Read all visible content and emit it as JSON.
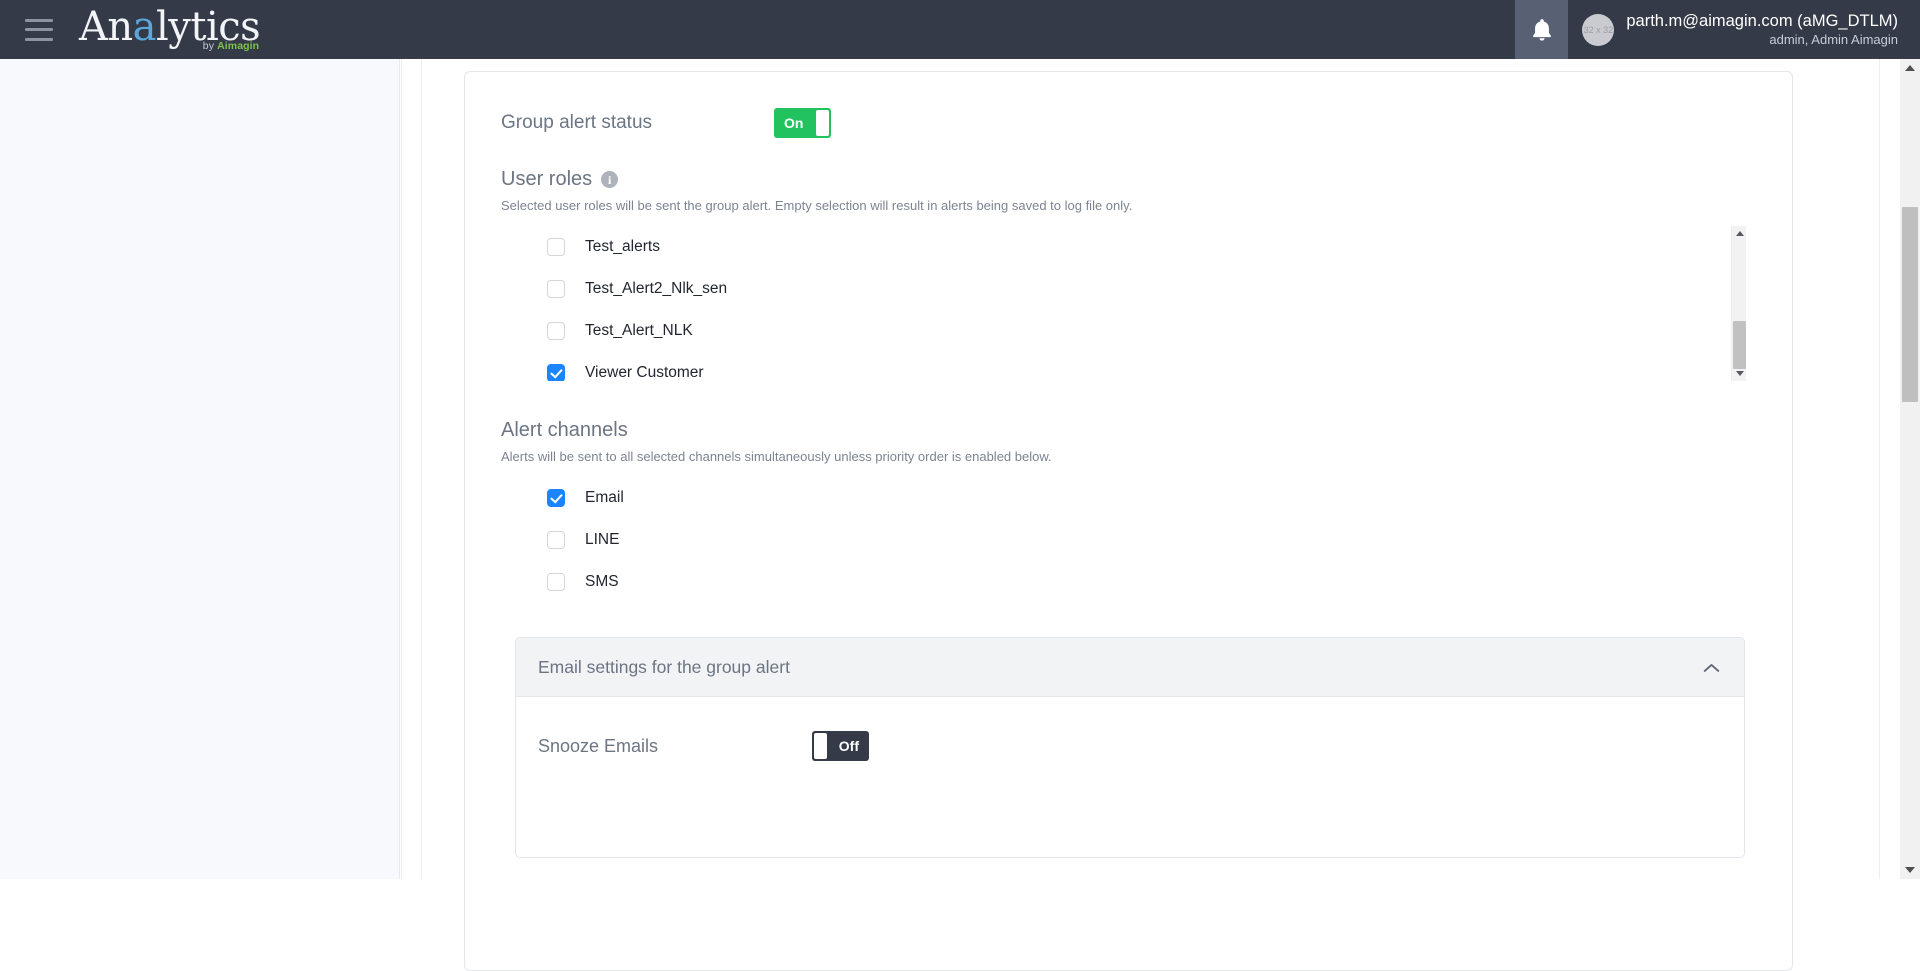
{
  "topbar": {
    "menu_icon": "hamburger-icon",
    "logo_text_pre": "An",
    "logo_text_accent": "a",
    "logo_text_post": "lytics",
    "logo_sub_pre": "by ",
    "logo_sub_brand": "Aimagin",
    "bell_icon": "notification-bell-icon",
    "avatar_placeholder": "32 x 32",
    "user_email": "parth.m@aimagin.com (aMG_DTLM)",
    "user_role": "admin, Admin Aimagin"
  },
  "group_alert_status": {
    "label": "Group alert status",
    "toggle_state": "On",
    "toggle_color": "#22c35e"
  },
  "user_roles": {
    "title": "User roles",
    "info_icon": "i",
    "description": "Selected user roles will be sent the group alert. Empty selection will result in alerts being saved to log file only.",
    "items": [
      {
        "label": "Test_alerts",
        "checked": false
      },
      {
        "label": "Test_Alert2_Nlk_sen",
        "checked": false
      },
      {
        "label": "Test_Alert_NLK",
        "checked": false
      },
      {
        "label": "Viewer Customer",
        "checked": true
      }
    ]
  },
  "alert_channels": {
    "title": "Alert channels",
    "description": "Alerts will be sent to all selected channels simultaneously unless priority order is enabled below.",
    "items": [
      {
        "label": "Email",
        "checked": true
      },
      {
        "label": "LINE",
        "checked": false
      },
      {
        "label": "SMS",
        "checked": false
      }
    ]
  },
  "email_settings_panel": {
    "title": "Email settings for the group alert",
    "collapse_icon": "chevron-up-icon",
    "snooze_label": "Snooze Emails",
    "snooze_state": "Off"
  },
  "colors": {
    "checkbox_accent": "#1a85ff",
    "toggle_on": "#22c35e",
    "toggle_off": "#343a48",
    "topbar": "#343a48"
  }
}
